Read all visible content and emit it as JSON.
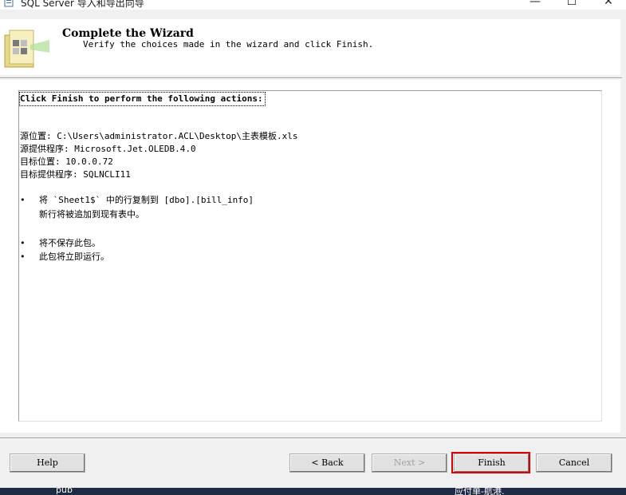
{
  "window": {
    "title": "SQL Server 导入和导出向导",
    "minimize_glyph": "—",
    "maximize_glyph": "☐",
    "close_glyph": "✕"
  },
  "header": {
    "title": "Complete the Wizard",
    "subtitle": "Verify the choices made in the wizard and click Finish."
  },
  "summary": {
    "heading": "Click Finish to perform the following actions:",
    "lines": [
      "源位置: C:\\Users\\administrator.ACL\\Desktop\\主表模板.xls",
      "源提供程序: Microsoft.Jet.OLEDB.4.0",
      "目标位置: 10.0.0.72",
      "目标提供程序: SQLNCLI11"
    ],
    "bullet_char": "•",
    "bullets": [
      "将 `Sheet1$` 中的行复制到 [dbo].[bill_info]",
      "新行将被追加到现有表中。",
      "将不保存此包。",
      "此包将立即运行。"
    ]
  },
  "buttons": {
    "help": "Help",
    "back": "< Back",
    "next": "Next >",
    "finish": "Finish",
    "cancel": "Cancel"
  },
  "taskbar": {
    "left_text": "pub",
    "right_text": "应付单-航港."
  },
  "colors": {
    "highlight": "#e00000",
    "disabled_text": "#a0a0a0"
  }
}
